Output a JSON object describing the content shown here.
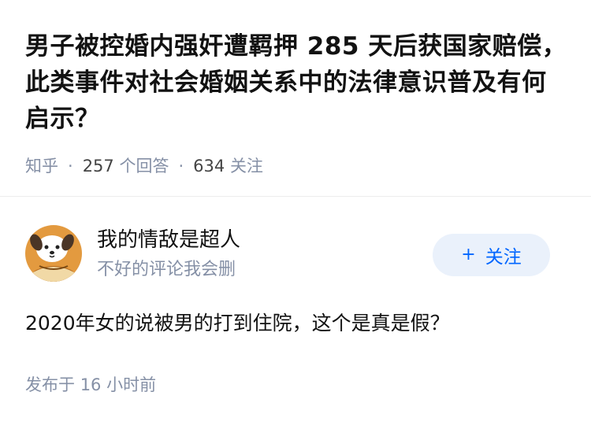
{
  "question": {
    "title": "男子被控婚内强奸遭羁押 285 天后获国家赔偿，此类事件对社会婚姻关系中的法律意识普及有何启示？",
    "source": "知乎",
    "separator": "·",
    "answer_count": "257",
    "answer_label": "个回答",
    "follow_count": "634",
    "follow_label": "关注"
  },
  "answer": {
    "author_name": "我的情敌是超人",
    "author_bio": "不好的评论我会删",
    "follow_plus": "+",
    "follow_label": "关注",
    "content": "2020年女的说被男的打到住院，这个是真是假？",
    "time_label": "发布于",
    "time_value": "16 小时前"
  },
  "colors": {
    "accent": "#0066ff",
    "follow_bg": "#eaf1fb",
    "meta_gray": "#8590a6",
    "avatar_bg": "#e39a3f"
  },
  "icons": {
    "avatar": "cartoon-dog-avatar-icon"
  }
}
